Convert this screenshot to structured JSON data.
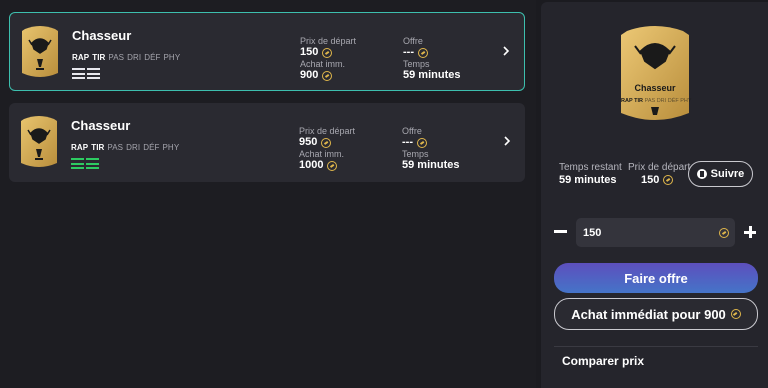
{
  "listings": [
    {
      "name": "Chasseur",
      "stats": [
        "RAP",
        "TIR",
        "PAS",
        "DRI",
        "DÉF",
        "PHY"
      ],
      "start_price_label": "Prix de départ",
      "start_price": "150",
      "buy_now_label": "Achat imm.",
      "buy_now": "900",
      "offer_label": "Offre",
      "offer": "---",
      "time_label": "Temps",
      "time": "59 minutes",
      "chem_color": "#e8e8ee"
    },
    {
      "name": "Chasseur",
      "stats": [
        "RAP",
        "TIR",
        "PAS",
        "DRI",
        "DÉF",
        "PHY"
      ],
      "start_price_label": "Prix de départ",
      "start_price": "950",
      "buy_now_label": "Achat imm.",
      "buy_now": "1000",
      "offer_label": "Offre",
      "offer": "---",
      "time_label": "Temps",
      "time": "59 minutes",
      "chem_color": "#2ecc62"
    }
  ],
  "detail": {
    "card_name": "Chasseur",
    "stats": [
      "RAP",
      "TIR",
      "PAS",
      "DRI",
      "DÉF",
      "PHY"
    ],
    "time_left_label": "Temps restant",
    "time_left": "59 minutes",
    "start_price_label": "Prix de départ",
    "start_price": "150",
    "follow_label": "Suivre",
    "offer_amount": "150",
    "make_offer_label": "Faire offre",
    "buy_now_label": "Achat immédiat pour 900",
    "compare_label": "Comparer prix"
  },
  "colors": {
    "card_gold": "#d9b25a",
    "accent_teal": "#3dbfae",
    "coin": "#e0b74b"
  }
}
